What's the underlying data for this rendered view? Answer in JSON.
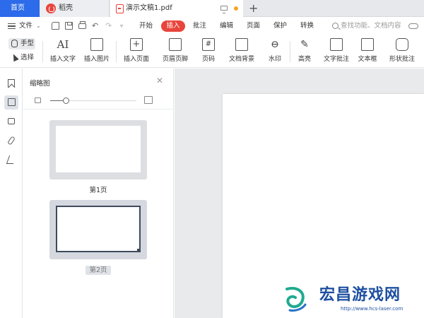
{
  "tabs": {
    "home": "首页",
    "daoke": "稻壳",
    "document": "演示文稿1.pdf"
  },
  "menu": {
    "file": "文件",
    "items": [
      "开始",
      "插入",
      "批注",
      "编辑",
      "页面",
      "保护",
      "转换"
    ],
    "active_item": "插入",
    "search_placeholder": "查找功能、文档内容"
  },
  "toolbar": {
    "hand_tool": "手型",
    "select_tool": "选择",
    "buttons": [
      "插入文字",
      "插入图片",
      "插入页面",
      "页眉页脚",
      "页码",
      "文档背景",
      "水印",
      "高亮",
      "文字批注",
      "文本框",
      "形状批注"
    ]
  },
  "thumbnail_panel": {
    "title": "缩略图",
    "zoom_fraction": 0.18,
    "pages": [
      "第1页",
      "第2页"
    ],
    "selected_page": 2
  },
  "watermark": {
    "title": "宏昌游戏网",
    "url": "http://www.hcs-laser.com"
  },
  "colors": {
    "home_tab": "#2c6be9",
    "accent_red": "#e8453c",
    "canvas_bg": "#e9eaec"
  }
}
